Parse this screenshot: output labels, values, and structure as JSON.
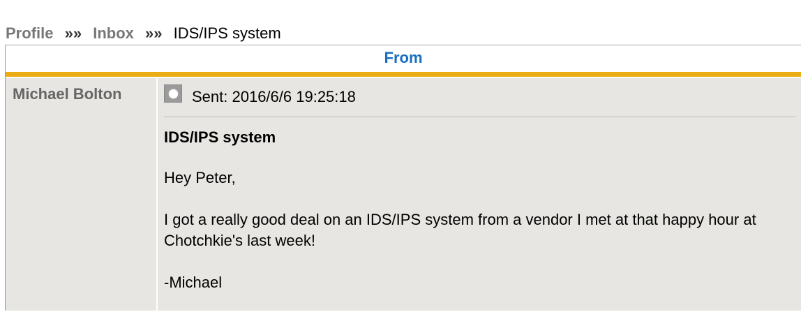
{
  "breadcrumb": {
    "profile": "Profile",
    "sep1": "»»",
    "inbox": "Inbox",
    "sep2": "»»",
    "current": "IDS/IPS system"
  },
  "table": {
    "header_from": "From"
  },
  "message": {
    "sender": "Michael Bolton",
    "icon": "message-status-icon",
    "sent": "Sent: 2016/6/6 19:25:18",
    "subject": "IDS/IPS system",
    "greeting": "Hey Peter,",
    "body": "I got a really good deal on an IDS/IPS system from a vendor I met at that happy hour at Chotchkie's last week!",
    "signature": "-Michael"
  },
  "colors": {
    "header_text": "#1a6fc4",
    "header_bar": "#ebad16",
    "cell_bg": "#e7e6e2",
    "link_gray": "#777777"
  }
}
